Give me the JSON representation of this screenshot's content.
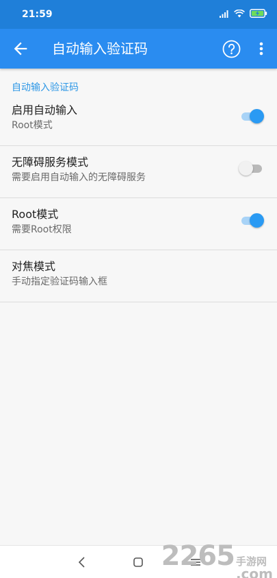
{
  "status_bar": {
    "time": "21:59",
    "icons": [
      "signal-icon",
      "wifi-icon",
      "battery-charging-icon"
    ]
  },
  "app_bar": {
    "title": "自动输入验证码",
    "back_icon": "arrow-back-icon",
    "help_icon": "help-icon",
    "more_icon": "more-vert-icon"
  },
  "section": {
    "header": "自动输入验证码"
  },
  "settings": [
    {
      "title": "启用自动输入",
      "subtitle": "Root模式",
      "enabled": true
    },
    {
      "title": "无障碍服务模式",
      "subtitle": "需要启用自动输入的无障碍服务",
      "enabled": false
    },
    {
      "title": "Root模式",
      "subtitle": "需要Root权限",
      "enabled": true
    },
    {
      "title": "对焦模式",
      "subtitle": "手动指定验证码输入框",
      "enabled": null
    }
  ],
  "nav_bar": {
    "icons": [
      "nav-back-icon",
      "nav-home-icon",
      "nav-recents-icon"
    ]
  },
  "watermark": {
    "number": "2265",
    "cn": "手游网",
    "com": ".com"
  },
  "colors": {
    "status_bar": "#1f7fd9",
    "app_bar": "#2a8cf0",
    "accent": "#2a9af3",
    "section_header": "#2d97e6",
    "background": "#f7f7f7"
  }
}
